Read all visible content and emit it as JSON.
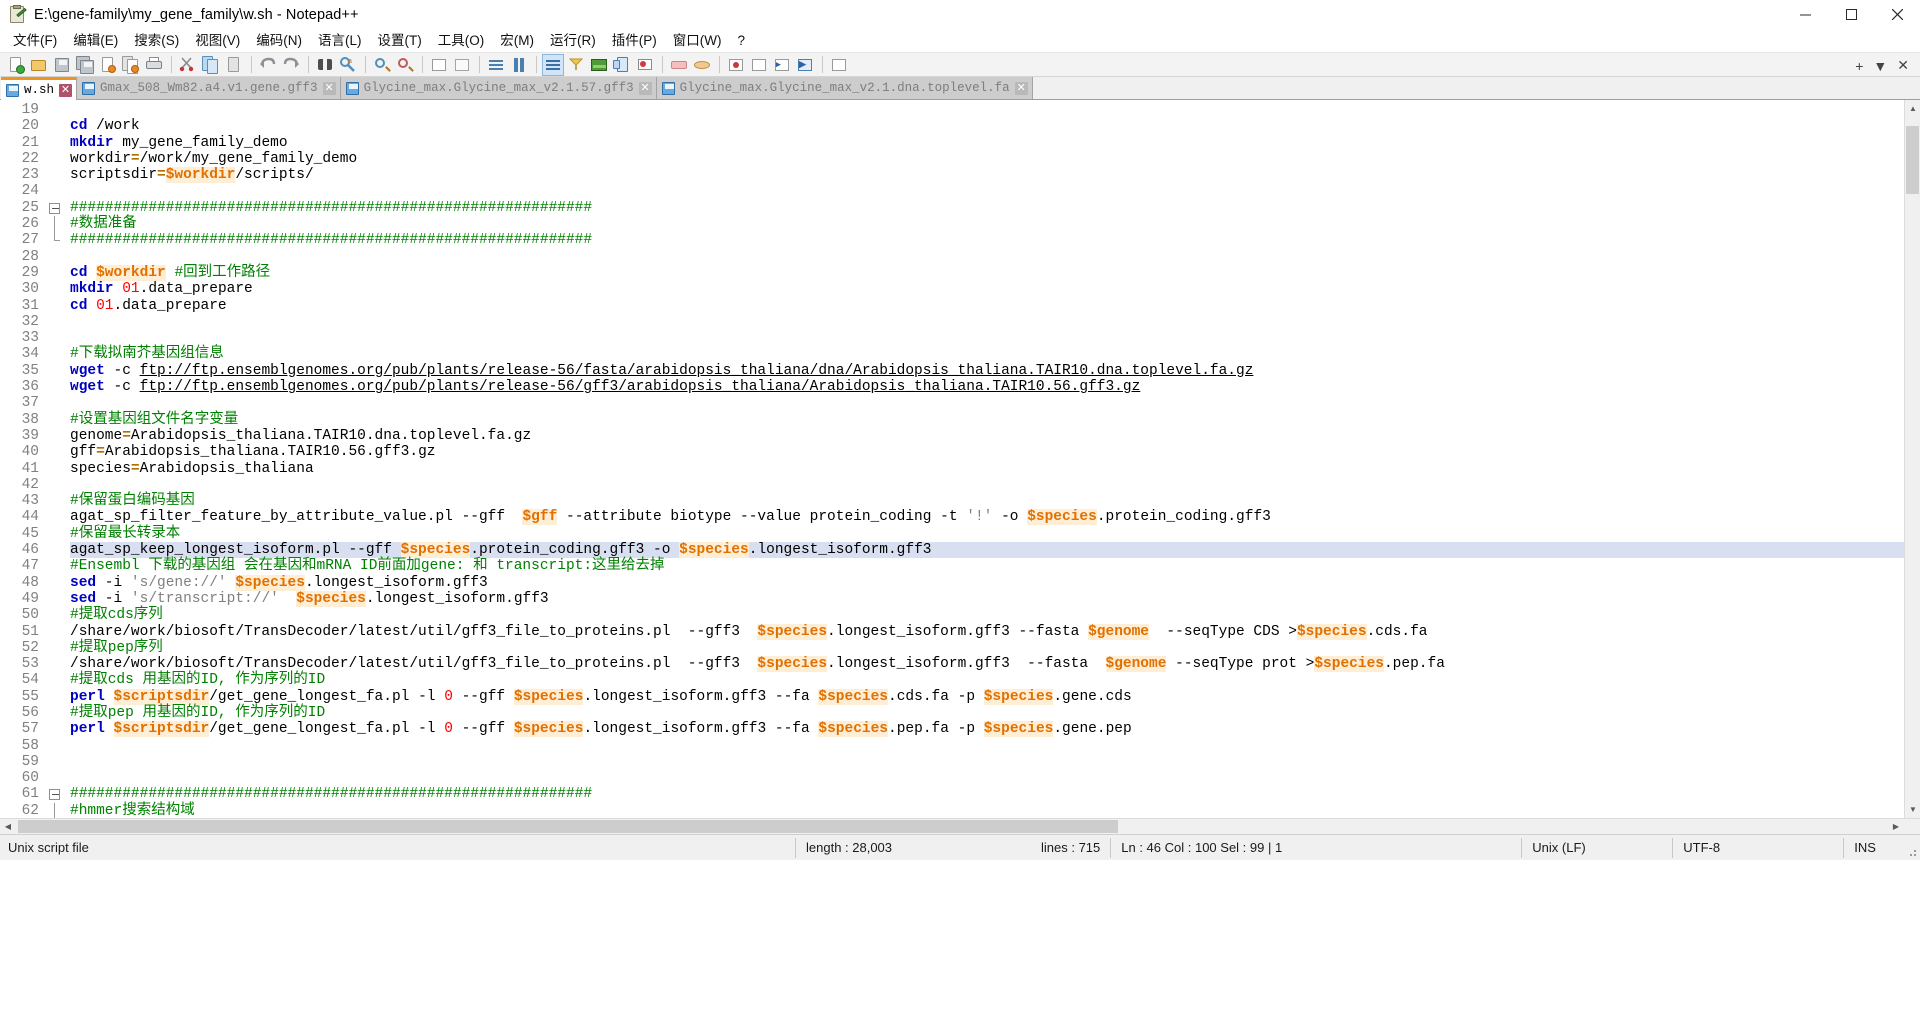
{
  "window": {
    "title": "E:\\gene-family\\my_gene_family\\w.sh - Notepad++",
    "icon": "notepad-plus-plus-icon",
    "minimize": "–",
    "maximize": "☐",
    "close": "✕"
  },
  "menu": [
    {
      "label": "文件(F)",
      "name": "menu-file"
    },
    {
      "label": "编辑(E)",
      "name": "menu-edit"
    },
    {
      "label": "搜索(S)",
      "name": "menu-search"
    },
    {
      "label": "视图(V)",
      "name": "menu-view"
    },
    {
      "label": "编码(N)",
      "name": "menu-encoding"
    },
    {
      "label": "语言(L)",
      "name": "menu-language"
    },
    {
      "label": "设置(T)",
      "name": "menu-settings"
    },
    {
      "label": "工具(O)",
      "name": "menu-tools"
    },
    {
      "label": "宏(M)",
      "name": "menu-macro"
    },
    {
      "label": "运行(R)",
      "name": "menu-run"
    },
    {
      "label": "插件(P)",
      "name": "menu-plugins"
    },
    {
      "label": "窗口(W)",
      "name": "menu-window"
    },
    {
      "label": "?",
      "name": "menu-help"
    }
  ],
  "toolbar_right": {
    "plus": "+",
    "chevron": "▼",
    "close": "✕"
  },
  "tabs": [
    {
      "label": "w.sh",
      "active": true,
      "name": "tab-w-sh"
    },
    {
      "label": "Gmax_508_Wm82.a4.v1.gene.gff3",
      "active": false,
      "name": "tab-gmax-gene-gff3"
    },
    {
      "label": "Glycine_max.Glycine_max_v2.1.57.gff3",
      "active": false,
      "name": "tab-glycine-57-gff3"
    },
    {
      "label": "Glycine_max.Glycine_max_v2.1.dna.toplevel.fa",
      "active": false,
      "name": "tab-glycine-dna-toplevel-fa"
    }
  ],
  "editor": {
    "first_line": 19,
    "selected_line": 46,
    "lines": [
      {
        "n": 19,
        "tokens": []
      },
      {
        "n": 20,
        "tokens": [
          {
            "t": "k",
            "v": "cd"
          },
          {
            "t": "pl",
            "v": " /work"
          }
        ]
      },
      {
        "n": 21,
        "tokens": [
          {
            "t": "k",
            "v": "mkdir"
          },
          {
            "t": "pl",
            "v": " my_gene_family_demo"
          }
        ]
      },
      {
        "n": 22,
        "tokens": [
          {
            "t": "pl",
            "v": "workdir"
          },
          {
            "t": "op",
            "v": "="
          },
          {
            "t": "pl",
            "v": "/work/my_gene_family_demo"
          }
        ]
      },
      {
        "n": 23,
        "tokens": [
          {
            "t": "pl",
            "v": "scriptsdir"
          },
          {
            "t": "op",
            "v": "="
          },
          {
            "t": "var",
            "v": "$workdir"
          },
          {
            "t": "pl",
            "v": "/scripts/"
          }
        ]
      },
      {
        "n": 24,
        "tokens": []
      },
      {
        "n": 25,
        "fold": "start",
        "tokens": [
          {
            "t": "cm",
            "v": "############################################################"
          }
        ]
      },
      {
        "n": 26,
        "fold": "mid",
        "tokens": [
          {
            "t": "cm",
            "v": "#数据准备"
          }
        ]
      },
      {
        "n": 27,
        "fold": "end",
        "tokens": [
          {
            "t": "cm",
            "v": "############################################################"
          }
        ]
      },
      {
        "n": 28,
        "tokens": []
      },
      {
        "n": 29,
        "tokens": [
          {
            "t": "k",
            "v": "cd"
          },
          {
            "t": "pl",
            "v": " "
          },
          {
            "t": "var",
            "v": "$workdir"
          },
          {
            "t": "pl",
            "v": " "
          },
          {
            "t": "cm",
            "v": "#回到工作路径"
          }
        ]
      },
      {
        "n": 30,
        "tokens": [
          {
            "t": "k",
            "v": "mkdir"
          },
          {
            "t": "pl",
            "v": " "
          },
          {
            "t": "nu",
            "v": "01"
          },
          {
            "t": "pl",
            "v": ".data_prepare"
          }
        ]
      },
      {
        "n": 31,
        "tokens": [
          {
            "t": "k",
            "v": "cd"
          },
          {
            "t": "pl",
            "v": " "
          },
          {
            "t": "nu",
            "v": "01"
          },
          {
            "t": "pl",
            "v": ".data_prepare"
          }
        ]
      },
      {
        "n": 32,
        "tokens": []
      },
      {
        "n": 33,
        "tokens": []
      },
      {
        "n": 34,
        "tokens": [
          {
            "t": "cm",
            "v": "#下载拟南芥基因组信息"
          }
        ]
      },
      {
        "n": 35,
        "tokens": [
          {
            "t": "k",
            "v": "wget"
          },
          {
            "t": "pl",
            "v": " -c "
          },
          {
            "t": "url",
            "v": "ftp://ftp.ensemblgenomes.org/pub/plants/release-56/fasta/arabidopsis_thaliana/dna/Arabidopsis_thaliana.TAIR10.dna.toplevel.fa.gz"
          }
        ]
      },
      {
        "n": 36,
        "tokens": [
          {
            "t": "k",
            "v": "wget"
          },
          {
            "t": "pl",
            "v": " -c "
          },
          {
            "t": "url",
            "v": "ftp://ftp.ensemblgenomes.org/pub/plants/release-56/gff3/arabidopsis_thaliana/Arabidopsis_thaliana.TAIR10.56.gff3.gz"
          }
        ]
      },
      {
        "n": 37,
        "tokens": []
      },
      {
        "n": 38,
        "tokens": [
          {
            "t": "cm",
            "v": "#设置基因组文件名字变量"
          }
        ]
      },
      {
        "n": 39,
        "tokens": [
          {
            "t": "pl",
            "v": "genome"
          },
          {
            "t": "op",
            "v": "="
          },
          {
            "t": "pl",
            "v": "Arabidopsis_thaliana.TAIR10.dna.toplevel.fa.gz"
          }
        ]
      },
      {
        "n": 40,
        "tokens": [
          {
            "t": "pl",
            "v": "gff"
          },
          {
            "t": "op",
            "v": "="
          },
          {
            "t": "pl",
            "v": "Arabidopsis_thaliana.TAIR10.56.gff3.gz"
          }
        ]
      },
      {
        "n": 41,
        "tokens": [
          {
            "t": "pl",
            "v": "species"
          },
          {
            "t": "op",
            "v": "="
          },
          {
            "t": "pl",
            "v": "Arabidopsis_thaliana"
          }
        ]
      },
      {
        "n": 42,
        "tokens": []
      },
      {
        "n": 43,
        "tokens": [
          {
            "t": "cm",
            "v": "#保留蛋白编码基因"
          }
        ]
      },
      {
        "n": 44,
        "tokens": [
          {
            "t": "pl",
            "v": "agat_sp_filter_feature_by_attribute_value.pl --gff  "
          },
          {
            "t": "var",
            "v": "$gff"
          },
          {
            "t": "pl",
            "v": " --attribute biotype --value protein_coding -t "
          },
          {
            "t": "st",
            "v": "'!'"
          },
          {
            "t": "pl",
            "v": " -o "
          },
          {
            "t": "var",
            "v": "$species"
          },
          {
            "t": "pl",
            "v": ".protein_coding.gff3"
          }
        ]
      },
      {
        "n": 45,
        "tokens": [
          {
            "t": "cm",
            "v": "#保留最长转录本"
          }
        ]
      },
      {
        "n": 46,
        "sel": true,
        "tokens": [
          {
            "t": "pl",
            "v": "agat_sp_keep_longest_isoform.pl --gff "
          },
          {
            "t": "var",
            "v": "$species"
          },
          {
            "t": "pl",
            "v": ".protein_coding.gff3 -o "
          },
          {
            "t": "var",
            "v": "$species"
          },
          {
            "t": "pl",
            "v": ".longest_isoform.gff3"
          }
        ]
      },
      {
        "n": 47,
        "tokens": [
          {
            "t": "cm",
            "v": "#Ensembl 下载的基因组 会在基因和mRNA ID前面加gene: 和 transcript:这里给去掉"
          }
        ]
      },
      {
        "n": 48,
        "tokens": [
          {
            "t": "k",
            "v": "sed"
          },
          {
            "t": "pl",
            "v": " -i "
          },
          {
            "t": "st",
            "v": "'s/gene://'"
          },
          {
            "t": "pl",
            "v": " "
          },
          {
            "t": "var",
            "v": "$species"
          },
          {
            "t": "pl",
            "v": ".longest_isoform.gff3"
          }
        ]
      },
      {
        "n": 49,
        "tokens": [
          {
            "t": "k",
            "v": "sed"
          },
          {
            "t": "pl",
            "v": " -i "
          },
          {
            "t": "st",
            "v": "'s/transcript://'"
          },
          {
            "t": "pl",
            "v": "  "
          },
          {
            "t": "var",
            "v": "$species"
          },
          {
            "t": "pl",
            "v": ".longest_isoform.gff3"
          }
        ]
      },
      {
        "n": 50,
        "tokens": [
          {
            "t": "cm",
            "v": "#提取cds序列"
          }
        ]
      },
      {
        "n": 51,
        "tokens": [
          {
            "t": "pl",
            "v": "/share/work/biosoft/TransDecoder/latest/util/gff3_file_to_proteins.pl  --gff3  "
          },
          {
            "t": "var",
            "v": "$species"
          },
          {
            "t": "pl",
            "v": ".longest_isoform.gff3 --fasta "
          },
          {
            "t": "var",
            "v": "$genome"
          },
          {
            "t": "pl",
            "v": "  --seqType CDS >"
          },
          {
            "t": "var",
            "v": "$species"
          },
          {
            "t": "pl",
            "v": ".cds.fa"
          }
        ]
      },
      {
        "n": 52,
        "tokens": [
          {
            "t": "cm",
            "v": "#提取pep序列"
          }
        ]
      },
      {
        "n": 53,
        "tokens": [
          {
            "t": "pl",
            "v": "/share/work/biosoft/TransDecoder/latest/util/gff3_file_to_proteins.pl  --gff3  "
          },
          {
            "t": "var",
            "v": "$species"
          },
          {
            "t": "pl",
            "v": ".longest_isoform.gff3  --fasta  "
          },
          {
            "t": "var",
            "v": "$genome"
          },
          {
            "t": "pl",
            "v": " --seqType prot >"
          },
          {
            "t": "var",
            "v": "$species"
          },
          {
            "t": "pl",
            "v": ".pep.fa"
          }
        ]
      },
      {
        "n": 54,
        "tokens": [
          {
            "t": "cm",
            "v": "#提取cds 用基因的ID, 作为序列的ID"
          }
        ]
      },
      {
        "n": 55,
        "tokens": [
          {
            "t": "k",
            "v": "perl"
          },
          {
            "t": "pl",
            "v": " "
          },
          {
            "t": "var",
            "v": "$scriptsdir"
          },
          {
            "t": "pl",
            "v": "/get_gene_longest_fa.pl -l "
          },
          {
            "t": "nu",
            "v": "0"
          },
          {
            "t": "pl",
            "v": " --gff "
          },
          {
            "t": "var",
            "v": "$species"
          },
          {
            "t": "pl",
            "v": ".longest_isoform.gff3 --fa "
          },
          {
            "t": "var",
            "v": "$species"
          },
          {
            "t": "pl",
            "v": ".cds.fa -p "
          },
          {
            "t": "var",
            "v": "$species"
          },
          {
            "t": "pl",
            "v": ".gene.cds"
          }
        ]
      },
      {
        "n": 56,
        "tokens": [
          {
            "t": "cm",
            "v": "#提取pep 用基因的ID, 作为序列的ID"
          }
        ]
      },
      {
        "n": 57,
        "tokens": [
          {
            "t": "k",
            "v": "perl"
          },
          {
            "t": "pl",
            "v": " "
          },
          {
            "t": "var",
            "v": "$scriptsdir"
          },
          {
            "t": "pl",
            "v": "/get_gene_longest_fa.pl -l "
          },
          {
            "t": "nu",
            "v": "0"
          },
          {
            "t": "pl",
            "v": " --gff "
          },
          {
            "t": "var",
            "v": "$species"
          },
          {
            "t": "pl",
            "v": ".longest_isoform.gff3 --fa "
          },
          {
            "t": "var",
            "v": "$species"
          },
          {
            "t": "pl",
            "v": ".pep.fa -p "
          },
          {
            "t": "var",
            "v": "$species"
          },
          {
            "t": "pl",
            "v": ".gene.pep"
          }
        ]
      },
      {
        "n": 58,
        "tokens": []
      },
      {
        "n": 59,
        "tokens": []
      },
      {
        "n": 60,
        "tokens": []
      },
      {
        "n": 61,
        "fold": "start",
        "tokens": [
          {
            "t": "cm",
            "v": "############################################################"
          }
        ]
      },
      {
        "n": 62,
        "fold": "mid",
        "tokens": [
          {
            "t": "cm",
            "v": "#hmmer搜索结构域"
          }
        ]
      }
    ]
  },
  "statusbar": {
    "filetype": "Unix script file",
    "length_label": "length : 28,003",
    "lines_label": "lines : 715",
    "position": "Ln : 46   Col : 100   Sel : 99 | 1",
    "eol": "Unix (LF)",
    "encoding": "UTF-8",
    "insert_mode": "INS"
  },
  "colors": {
    "tab_active_accent": "#ef9421",
    "keyword": "#0000c0",
    "comment": "#008000",
    "number": "#ff0000",
    "variable": "#e07000",
    "selection": "#d8dff0"
  }
}
